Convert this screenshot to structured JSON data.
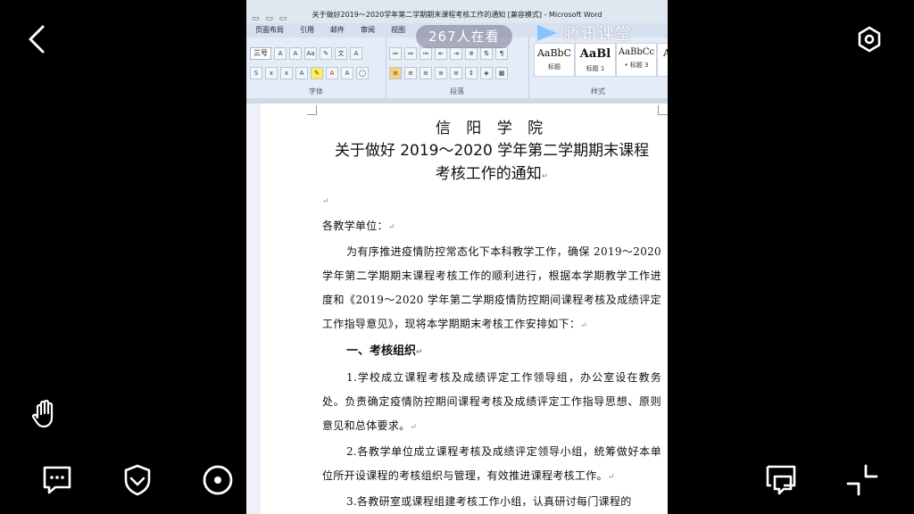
{
  "window": {
    "title": "关于做好2019～2020学年第二学期期末课程考核工作的通知 [兼容模式] - Microsoft Word"
  },
  "ribbon": {
    "tabs": [
      "页面布局",
      "引用",
      "邮件",
      "审阅",
      "视图"
    ],
    "font_size": "三号",
    "groups": {
      "font": "字体",
      "paragraph": "段落",
      "styles": "样式"
    },
    "styles": [
      {
        "sample": "AaBbC",
        "name": "标题"
      },
      {
        "sample": "AaBl",
        "name": "标题 1"
      },
      {
        "sample": "AaBbCc",
        "name": "• 标题 3"
      },
      {
        "sample": "A",
        "name": ""
      }
    ]
  },
  "overlay": {
    "viewers": "267人在看",
    "brand": "腾讯课堂"
  },
  "document": {
    "school": "信 阳 学 院",
    "title_line1": "关于做好 2019～2020 学年第二学期期末课程",
    "title_line2": "考核工作的通知",
    "para_mark": "↵",
    "greeting": "各教学单位：",
    "intro": "为有序推进疫情防控常态化下本科教学工作，确保 2019～2020 学年第二学期期末课程考核工作的顺利进行，根据本学期教学工作进度和《2019～2020 学年第二学期疫情防控期间课程考核及成绩评定工作指导意见》，现将本学期期末考核工作安排如下：",
    "section1": "一、考核组织",
    "item1": "1.学校成立课程考核及成绩评定工作领导组，办公室设在教务处。负责确定疫情防控期间课程考核及成绩评定工作指导思想、原则意见和总体要求。",
    "item2": "2.各教学单位成立课程考核及成绩评定领导小组，统筹做好本单位所开设课程的考核组织与管理，有效推进课程考核工作。",
    "item3": "3.各教研室或课程组建考核工作小组，认真研讨每门课程的"
  },
  "controls": {
    "back": "back-arrow-icon",
    "settings": "settings-hex-icon",
    "hand": "raise-hand-icon",
    "comment": "comment-icon",
    "shield": "shield-icon",
    "target": "target-icon",
    "share": "share-icon",
    "screen": "screen-comment-icon",
    "collapse": "collapse-icon"
  }
}
